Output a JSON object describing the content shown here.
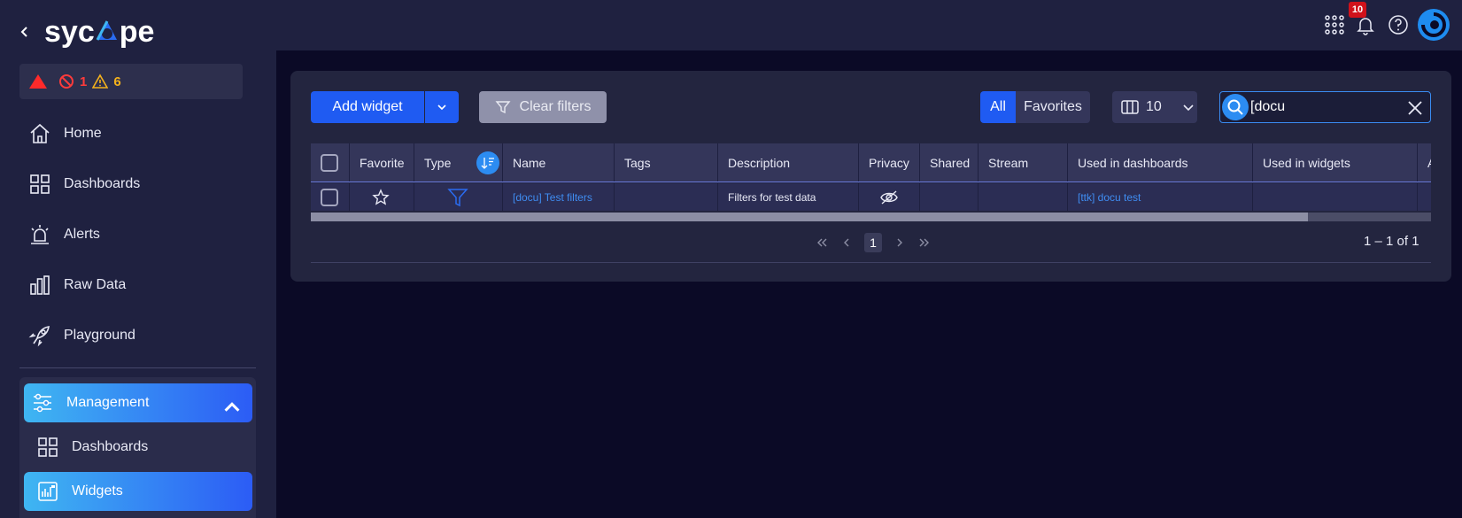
{
  "app": {
    "logo_text_a": "syc",
    "logo_text_b": "pe"
  },
  "alarms": {
    "critical": "",
    "blocked": "1",
    "warning": "6"
  },
  "nav": [
    {
      "label": "Home",
      "icon": "home-icon"
    },
    {
      "label": "Dashboards",
      "icon": "grid-icon"
    },
    {
      "label": "Alerts",
      "icon": "siren-icon"
    },
    {
      "label": "Raw Data",
      "icon": "bar-chart-icon"
    },
    {
      "label": "Playground",
      "icon": "rocket-icon"
    }
  ],
  "management": {
    "label": "Management",
    "items": [
      {
        "label": "Dashboards"
      },
      {
        "label": "Widgets"
      }
    ]
  },
  "topbar": {
    "notifications": "10"
  },
  "toolbar": {
    "add_widget": "Add widget",
    "clear_filters": "Clear filters",
    "all": "All",
    "favorites": "Favorites",
    "page_size": "10",
    "search_value": "[docu"
  },
  "table": {
    "headers": [
      "Favorite",
      "Type",
      "Name",
      "Tags",
      "Description",
      "Privacy",
      "Shared",
      "Stream",
      "Used in dashboards",
      "Used in widgets",
      "A"
    ],
    "rows": [
      {
        "name": "[docu] Test filters",
        "tags": "",
        "description": "Filters for test data",
        "shared": "",
        "stream": "",
        "used_in_dashboards": "[ttk] docu test",
        "used_in_widgets": ""
      }
    ]
  },
  "pagination": {
    "current": "1",
    "range": "1 – 1 of 1"
  },
  "colors": {
    "accent": "#1f5bf2",
    "link": "#3f8df2",
    "sidebar": "#1f2140",
    "background": "#0b0a26"
  }
}
